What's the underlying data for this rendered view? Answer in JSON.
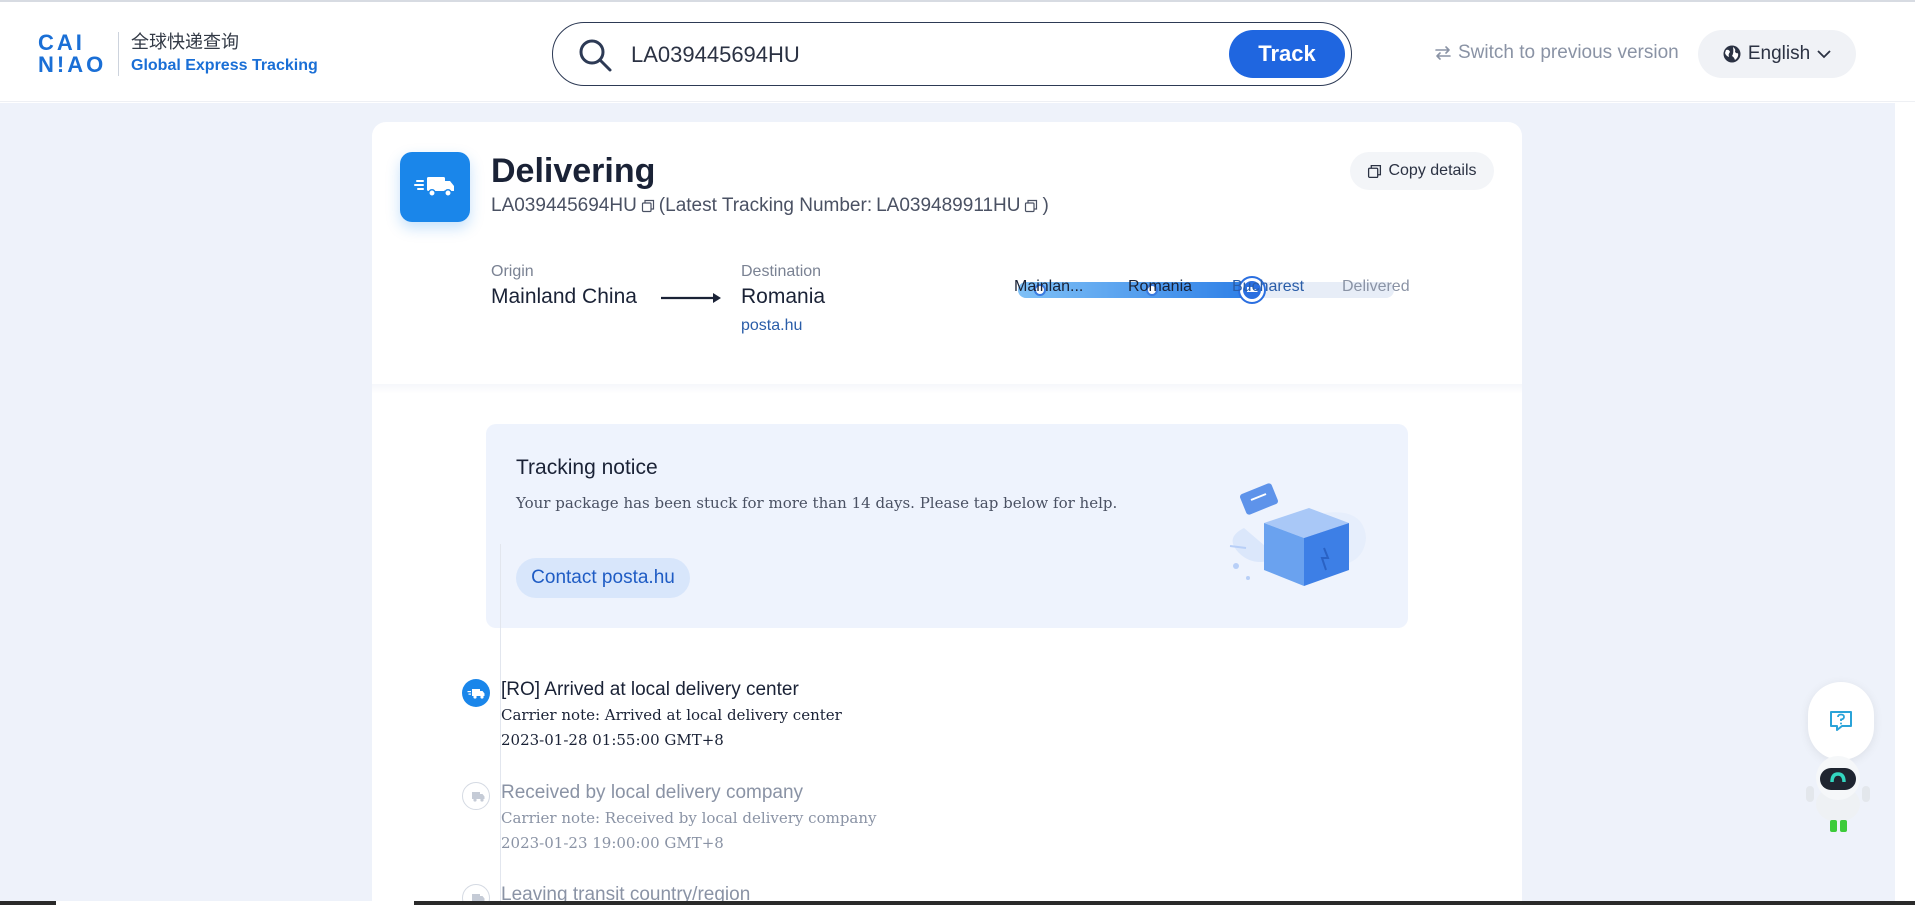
{
  "header": {
    "logo_top": "CAI",
    "logo_bottom": "N!AO",
    "logo_cn": "全球快递查询",
    "logo_en": "Global Express Tracking",
    "search_value": "LA039445694HU",
    "track_label": "Track",
    "switch_label": "Switch to previous version",
    "language": "English"
  },
  "shipment": {
    "status": "Delivering",
    "tracking_number": "LA039445694HU",
    "latest_prefix": "(Latest Tracking Number:",
    "latest_number": "LA039489911HU",
    "latest_suffix": ")",
    "copy_details_label": "Copy details",
    "origin_label": "Origin",
    "origin_value": "Mainland China",
    "destination_label": "Destination",
    "destination_value": "Romania",
    "carrier": "posta.hu"
  },
  "progress": {
    "steps": [
      "Mainlan...",
      "Romania",
      "Bucharest",
      "Delivered"
    ],
    "current_step": 2,
    "fill_fraction": 0.64
  },
  "notice": {
    "title": "Tracking notice",
    "text": "Your package has been stuck for more than 14 days. Please tap below for help.",
    "button_label": "Contact posta.hu"
  },
  "timeline": [
    {
      "title": "[RO] Arrived at local delivery center",
      "note": "Carrier note: Arrived at local delivery center",
      "time": "2023-01-28 01:55:00 GMT+8",
      "active": true
    },
    {
      "title": "Received by local delivery company",
      "note": "Carrier note: Received by local delivery company",
      "time": "2023-01-23 19:00:00 GMT+8",
      "active": false
    },
    {
      "title": "Leaving transit country/region",
      "note": "",
      "time": "",
      "active": false
    }
  ],
  "colors": {
    "brand_blue": "#1f66e0",
    "status_icon_bg": "#1a86ea",
    "page_bg": "#eef2fa",
    "notice_bg": "#eef3fd",
    "link_blue": "#2a5da8"
  },
  "icons": {
    "search": "search-icon",
    "switch": "switch-arrows-icon",
    "globe": "globe-icon",
    "chevron": "chevron-down-icon",
    "truck": "truck-icon",
    "copy": "copy-icon",
    "arrow": "arrow-right-icon",
    "help": "help-question-icon",
    "robot": "robot-assistant-icon"
  }
}
